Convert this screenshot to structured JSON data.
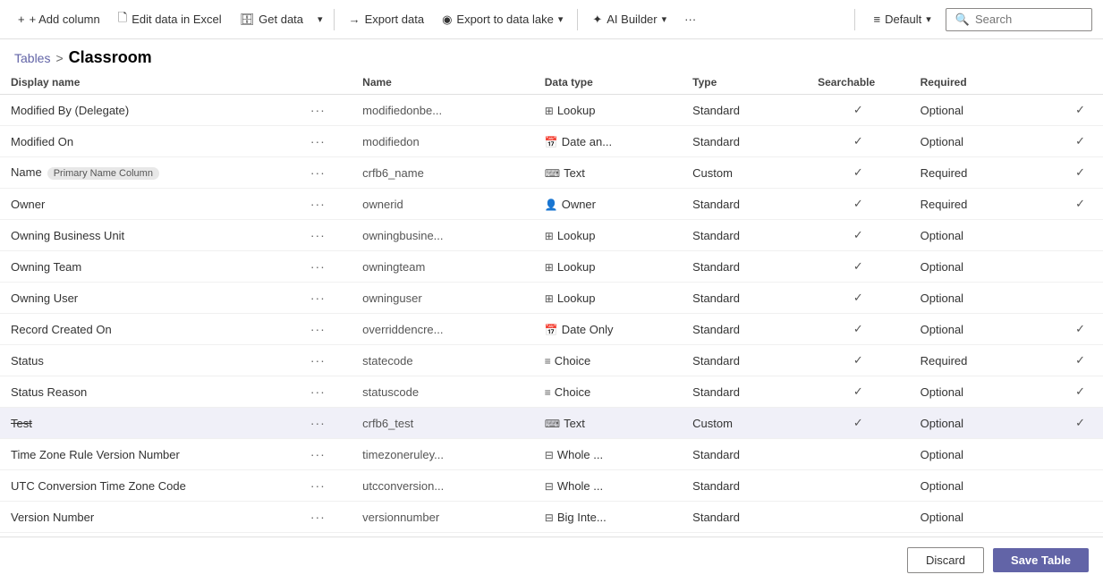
{
  "toolbar": {
    "add_column": "+ Add column",
    "edit_excel": "Edit data in Excel",
    "get_data": "Get data",
    "dropdown1": "",
    "export_data": "Export data",
    "export_lake": "Export to data lake",
    "ai_builder": "AI Builder",
    "more": "···",
    "default": "Default",
    "search_placeholder": "Search"
  },
  "breadcrumb": {
    "parent": "Tables",
    "separator": ">",
    "current": "Classroom"
  },
  "columns": {
    "col1": "Display name",
    "col2": "",
    "col3": "Name",
    "col4": "Data type",
    "col5": "Type",
    "col6": "Searchable",
    "col7": "Required",
    "col8": ""
  },
  "rows": [
    {
      "name": "Modified By (Delegate)",
      "dots": "···",
      "field": "modifiedonbe...",
      "type_icon": "⊞",
      "type": "Lookup",
      "category": "Standard",
      "searchable": true,
      "required": "Optional",
      "req_check": true,
      "selected": false,
      "strikethrough": false,
      "tag": ""
    },
    {
      "name": "Modified On",
      "dots": "···",
      "field": "modifiedon",
      "type_icon": "📅",
      "type": "Date an...",
      "category": "Standard",
      "searchable": true,
      "required": "Optional",
      "req_check": true,
      "selected": false,
      "strikethrough": false,
      "tag": ""
    },
    {
      "name": "Name",
      "dots": "···",
      "field": "crfb6_name",
      "type_icon": "⌨",
      "type": "Text",
      "category": "Custom",
      "searchable": true,
      "required": "Required",
      "req_check": true,
      "selected": false,
      "strikethrough": false,
      "tag": "Primary Name Column"
    },
    {
      "name": "Owner",
      "dots": "···",
      "field": "ownerid",
      "type_icon": "👤",
      "type": "Owner",
      "category": "Standard",
      "searchable": true,
      "required": "Required",
      "req_check": true,
      "selected": false,
      "strikethrough": false,
      "tag": ""
    },
    {
      "name": "Owning Business Unit",
      "dots": "···",
      "field": "owningbusine...",
      "type_icon": "⊞",
      "type": "Lookup",
      "category": "Standard",
      "searchable": true,
      "required": "Optional",
      "req_check": false,
      "selected": false,
      "strikethrough": false,
      "tag": ""
    },
    {
      "name": "Owning Team",
      "dots": "···",
      "field": "owningteam",
      "type_icon": "⊞",
      "type": "Lookup",
      "category": "Standard",
      "searchable": true,
      "required": "Optional",
      "req_check": false,
      "selected": false,
      "strikethrough": false,
      "tag": ""
    },
    {
      "name": "Owning User",
      "dots": "···",
      "field": "owninguser",
      "type_icon": "⊞",
      "type": "Lookup",
      "category": "Standard",
      "searchable": true,
      "required": "Optional",
      "req_check": false,
      "selected": false,
      "strikethrough": false,
      "tag": ""
    },
    {
      "name": "Record Created On",
      "dots": "···",
      "field": "overriddencre...",
      "type_icon": "📅",
      "type": "Date Only",
      "category": "Standard",
      "searchable": true,
      "required": "Optional",
      "req_check": true,
      "selected": false,
      "strikethrough": false,
      "tag": ""
    },
    {
      "name": "Status",
      "dots": "···",
      "field": "statecode",
      "type_icon": "≡",
      "type": "Choice",
      "category": "Standard",
      "searchable": true,
      "required": "Required",
      "req_check": true,
      "selected": false,
      "strikethrough": false,
      "tag": ""
    },
    {
      "name": "Status Reason",
      "dots": "···",
      "field": "statuscode",
      "type_icon": "≡",
      "type": "Choice",
      "category": "Standard",
      "searchable": true,
      "required": "Optional",
      "req_check": true,
      "selected": false,
      "strikethrough": false,
      "tag": ""
    },
    {
      "name": "Test",
      "dots": "···",
      "field": "crfb6_test",
      "type_icon": "⌨",
      "type": "Text",
      "category": "Custom",
      "searchable": true,
      "required": "Optional",
      "req_check": true,
      "selected": true,
      "strikethrough": true,
      "tag": ""
    },
    {
      "name": "Time Zone Rule Version Number",
      "dots": "···",
      "field": "timezoneruley...",
      "type_icon": "⊟",
      "type": "Whole ...",
      "category": "Standard",
      "searchable": false,
      "required": "Optional",
      "req_check": false,
      "selected": false,
      "strikethrough": false,
      "tag": ""
    },
    {
      "name": "UTC Conversion Time Zone Code",
      "dots": "···",
      "field": "utcconversion...",
      "type_icon": "⊟",
      "type": "Whole ...",
      "category": "Standard",
      "searchable": false,
      "required": "Optional",
      "req_check": false,
      "selected": false,
      "strikethrough": false,
      "tag": ""
    },
    {
      "name": "Version Number",
      "dots": "···",
      "field": "versionnumber",
      "type_icon": "⊟",
      "type": "Big Inte...",
      "category": "Standard",
      "searchable": false,
      "required": "Optional",
      "req_check": false,
      "selected": false,
      "strikethrough": false,
      "tag": ""
    }
  ],
  "footer": {
    "discard": "Discard",
    "save": "Save Table"
  }
}
